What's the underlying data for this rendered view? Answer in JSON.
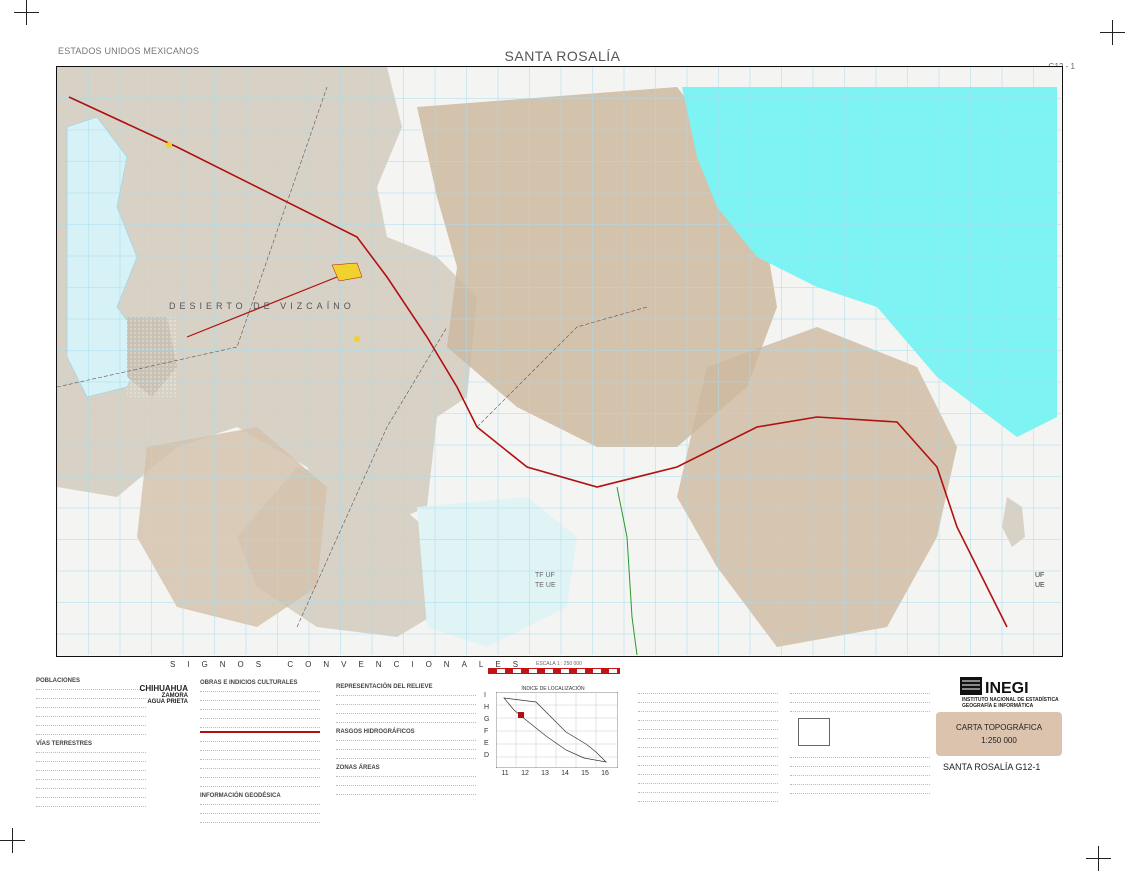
{
  "header": {
    "country": "ESTADOS UNIDOS MEXICANOS",
    "title": "SANTA ROSALÍA",
    "sheet_code": "G12 - 1"
  },
  "map": {
    "region_label": "DESIERTO DE VIZCAÍNO",
    "zone_labels": [
      "TF UF",
      "TE UE",
      "UF",
      "UE"
    ],
    "colors": {
      "sea": "#7df3f3",
      "desert": "#d8d2c6",
      "mountain": "#c9b49b",
      "road": "#b01010",
      "grid": "#a8dcee",
      "lagoon": "#c7eef3"
    }
  },
  "legend": {
    "signos_title": "SIGNOS CONVENCIONALES",
    "poblaciones_title": "POBLACIONES",
    "vias_title": "VÍAS TERRESTRES",
    "obras_title": "OBRAS E INDICIOS CULTURALES",
    "informacion_title": "INFORMACIÓN GEODÉSICA",
    "relieve_title": "REPRESENTACIÓN DEL RELIEVE",
    "hidro_title": "RASGOS HIDROGRÁFICOS",
    "zonas_title": "ZONAS ÁREAS",
    "sample_towns": [
      "CHIHUAHUA",
      "ZAMORA",
      "AGUA PRIETA"
    ],
    "escala_label": "ESCALA 1 : 250 000",
    "localizacion_title": "ÍNDICE DE LOCALIZACIÓN",
    "loc_rows": [
      "I",
      "H",
      "G",
      "F",
      "E",
      "D"
    ],
    "loc_cols": [
      "11",
      "12",
      "13",
      "14",
      "15",
      "16"
    ]
  },
  "publisher": {
    "name": "INEGI",
    "full_name": "INSTITUTO NACIONAL DE ESTADÍSTICA GEOGRAFÍA E INFORMÁTICA",
    "product": "CARTA TOPOGRÁFICA",
    "scale": "1:250 000",
    "sheet": "SANTA ROSALÍA G12-1"
  }
}
